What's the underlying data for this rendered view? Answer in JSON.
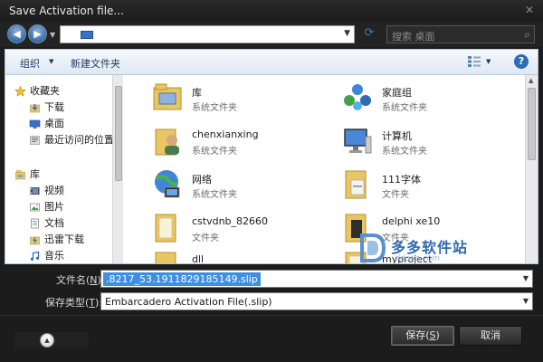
{
  "window": {
    "title": "Save Activation file...",
    "close_glyph": "✕"
  },
  "navbar": {
    "back_glyph": "◀",
    "forward_glyph": "▶",
    "dropdown_glyph": "▼",
    "address_dropdown_glyph": "▼",
    "refresh_glyph": "⟳",
    "search_placeholder": "搜索 桌面",
    "search_glyph": "⌕"
  },
  "toolbar": {
    "organize_label": "组织",
    "organize_arrow": "▼",
    "new_folder_label": "新建文件夹",
    "views_arrow": "▼",
    "help_label": "?"
  },
  "sidebar": {
    "items": [
      {
        "label": "收藏夹",
        "icon": "star-icon"
      },
      {
        "label": "下载",
        "icon": "download-folder-icon"
      },
      {
        "label": "桌面",
        "icon": "desktop-icon"
      },
      {
        "label": "最近访问的位置",
        "icon": "recent-places-icon"
      },
      {
        "label": "库",
        "icon": "library-icon"
      },
      {
        "label": "视频",
        "icon": "video-icon"
      },
      {
        "label": "图片",
        "icon": "picture-icon"
      },
      {
        "label": "文档",
        "icon": "document-icon"
      },
      {
        "label": "迅雷下载",
        "icon": "thunder-icon"
      },
      {
        "label": "音乐",
        "icon": "music-icon"
      }
    ]
  },
  "files": [
    {
      "name": "库",
      "type": "系统文件夹",
      "icon": "library-folder-icon"
    },
    {
      "name": "家庭组",
      "type": "系统文件夹",
      "icon": "homegroup-icon"
    },
    {
      "name": "chenxianxing",
      "type": "系统文件夹",
      "icon": "user-folder-icon"
    },
    {
      "name": "计算机",
      "type": "系统文件夹",
      "icon": "computer-icon"
    },
    {
      "name": "网络",
      "type": "系统文件夹",
      "icon": "network-icon"
    },
    {
      "name": "111字体",
      "type": "文件夹",
      "icon": "folder-icon"
    },
    {
      "name": "cstvdnb_82660",
      "type": "文件夹",
      "icon": "folder-icon"
    },
    {
      "name": "delphi xe10",
      "type": "文件夹",
      "icon": "folder-icon"
    },
    {
      "name": "dll",
      "type": "",
      "icon": "folder-icon"
    },
    {
      "name": "myproject",
      "type": "",
      "icon": "folder-icon"
    }
  ],
  "watermark": {
    "text": "多多软件站",
    "url": "ddooo.com"
  },
  "form": {
    "filename_label": "文件名(",
    "filename_hotkey": "N",
    "filename_label_end": "):",
    "filename_value": ".8217_53.1911829185149.slip",
    "filetype_label": "保存类型(",
    "filetype_hotkey": "T",
    "filetype_label_end": "):",
    "filetype_value": "Embarcadero Activation File(.slip)",
    "dropdown_glyph": "▼"
  },
  "footer": {
    "hide_folders_glyph": "▲",
    "save_label": "保存(",
    "save_hotkey": "S",
    "save_label_end": ")",
    "cancel_label": "取消"
  },
  "colors": {
    "selection": "#3f8fe0",
    "accent": "#2f6bb7",
    "dark_chrome": "#1c1c1c"
  }
}
